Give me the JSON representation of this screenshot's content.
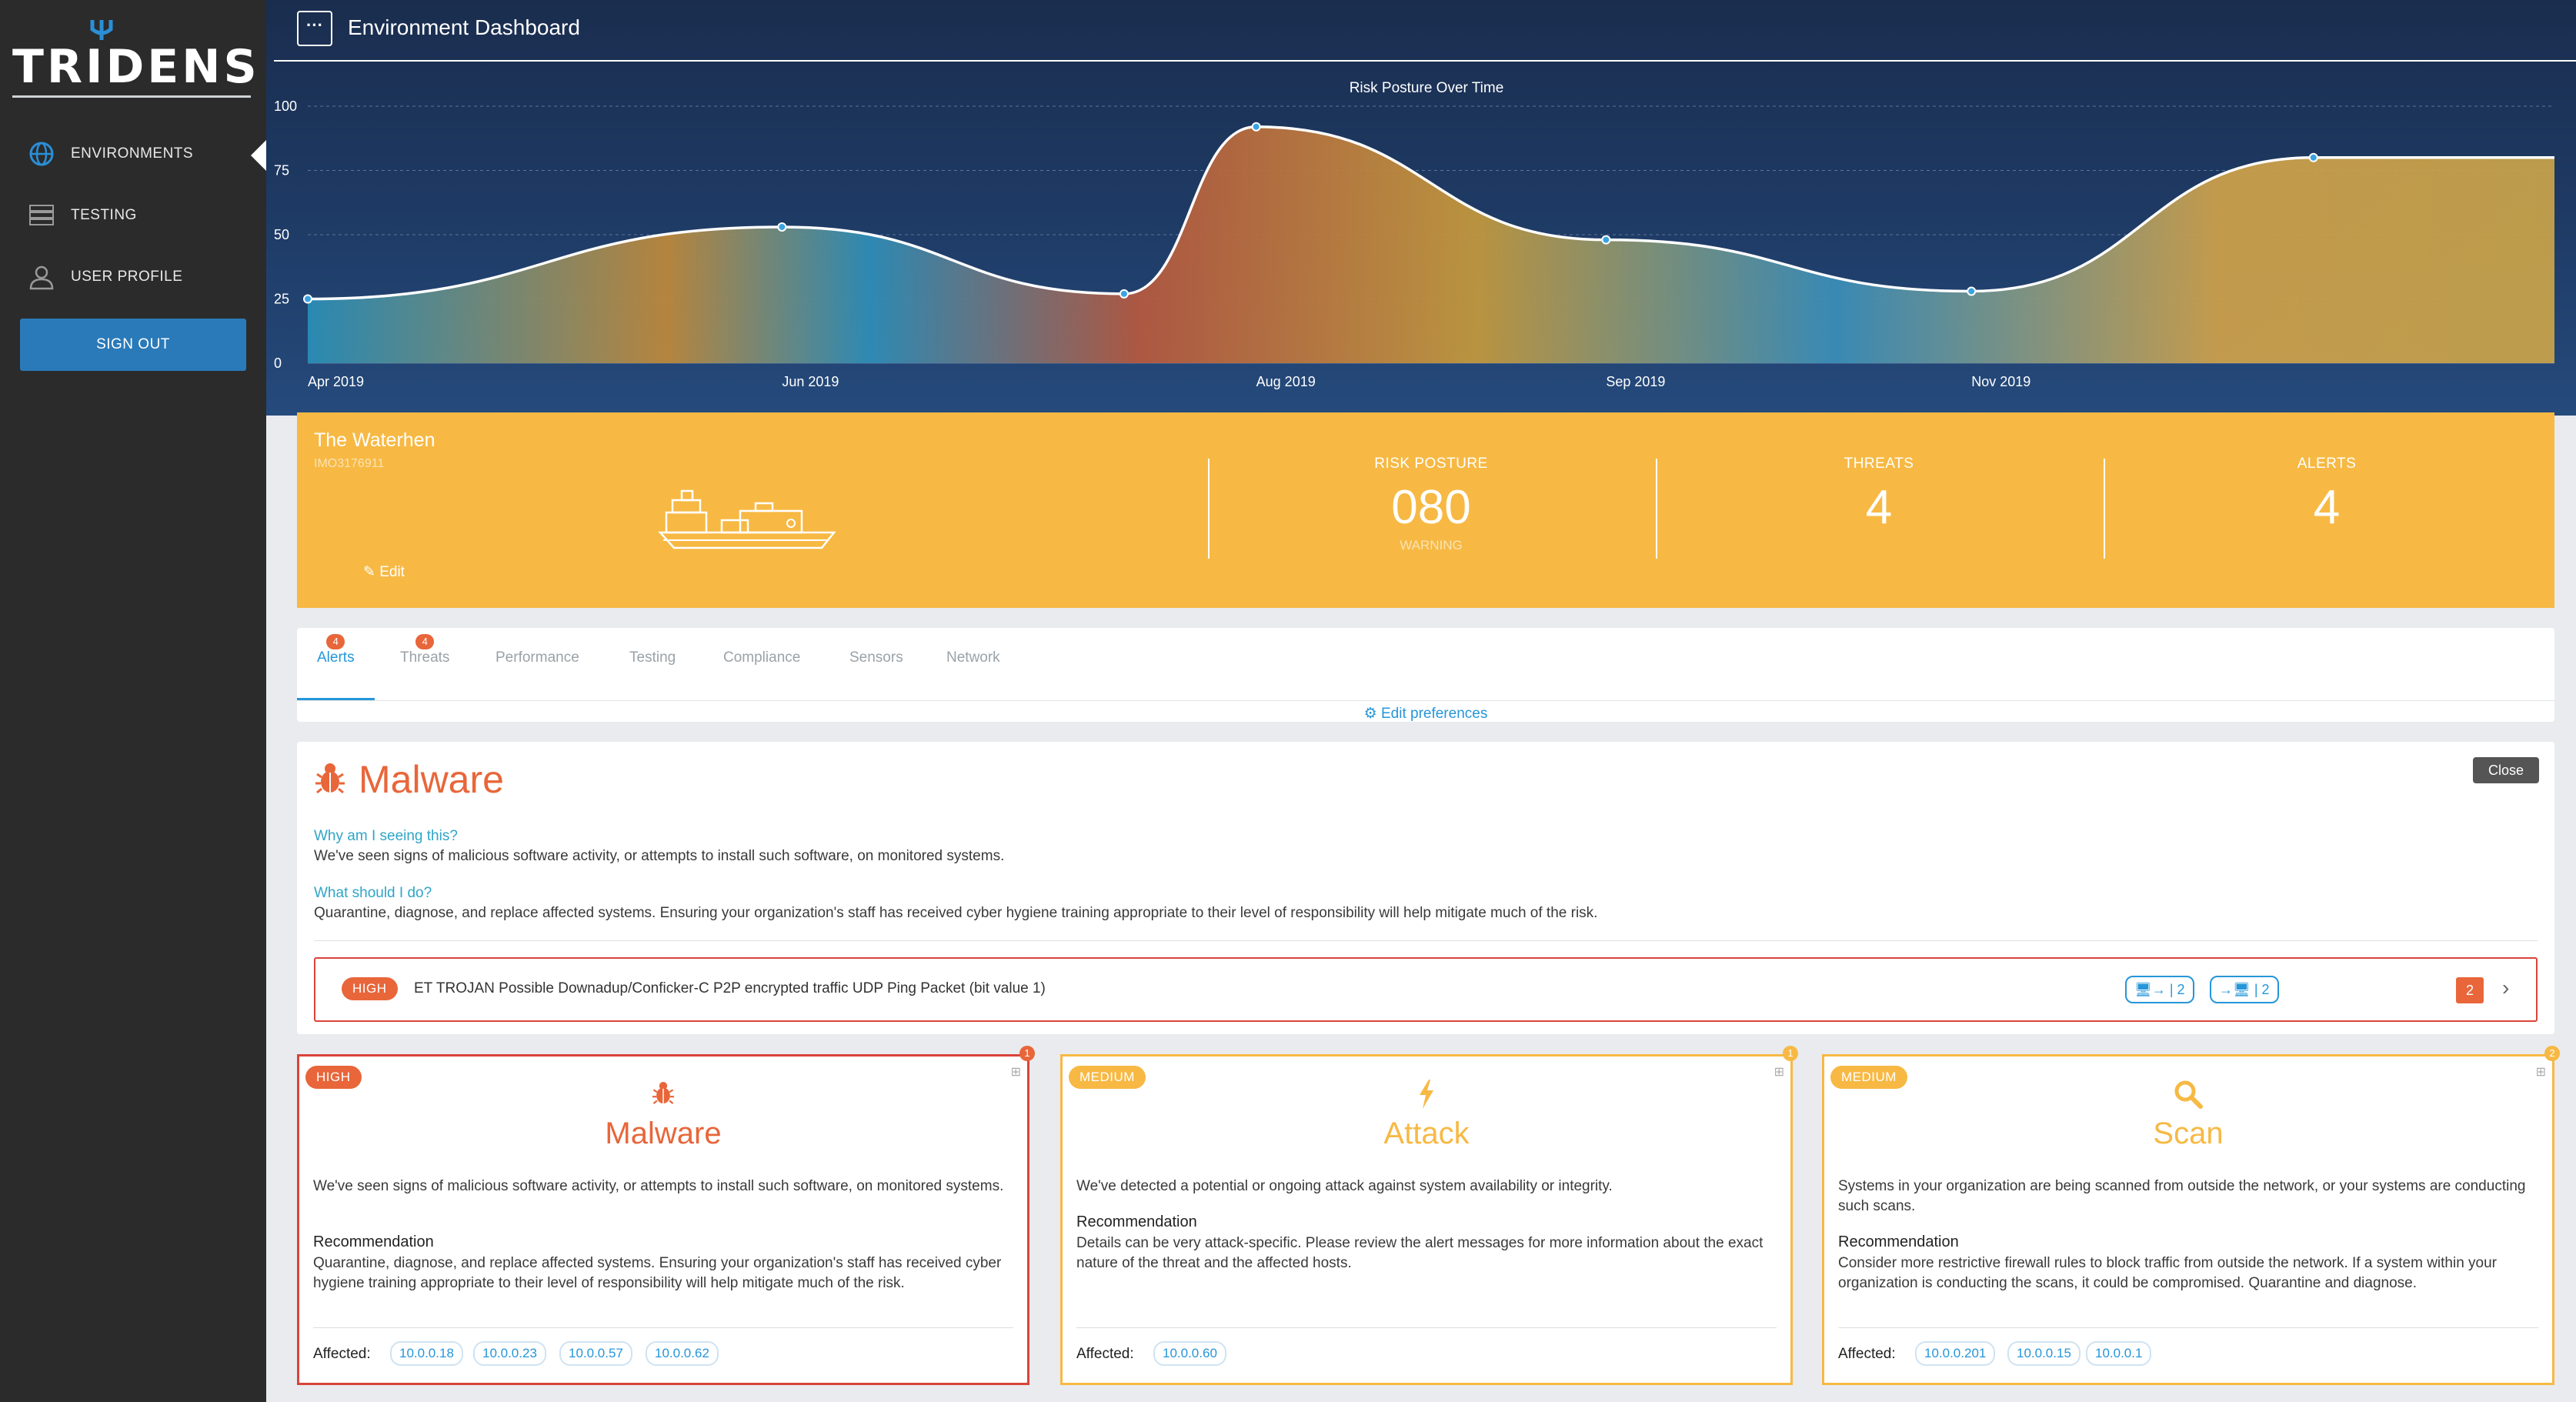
{
  "brand": {
    "logo_text": "TRIDENS"
  },
  "sidebar": {
    "items": [
      {
        "label": "ENVIRONMENTS",
        "icon": "globe-icon",
        "active": true
      },
      {
        "label": "TESTING",
        "icon": "server-rack-icon",
        "active": false
      },
      {
        "label": "USER PROFILE",
        "icon": "user-icon",
        "active": false
      }
    ],
    "signout_label": "SIGN OUT"
  },
  "header": {
    "title": "Environment Dashboard",
    "menu_label": "···"
  },
  "chart_data": {
    "type": "area",
    "title": "Risk Posture Over Time",
    "x_tick_labels": [
      "Apr 2019",
      "Jun 2019",
      "Aug 2019",
      "Sep 2019",
      "Nov 2019"
    ],
    "y_ticks": [
      0,
      25,
      50,
      75,
      100
    ],
    "ylim": [
      0,
      100
    ],
    "grid": true,
    "series": [
      {
        "x": [
          "2019-04-01",
          "2019-06-01",
          "2019-07-15",
          "2019-08-01",
          "2019-09-15",
          "2019-11-01",
          "2019-12-15",
          "2020-01-15"
        ],
        "values": [
          25,
          53,
          27,
          92,
          48,
          28,
          80,
          80
        ]
      }
    ]
  },
  "vessel": {
    "name": "The Waterhen",
    "id": "IMO3176911",
    "edit_label": "Edit",
    "stats": [
      {
        "label": "RISK POSTURE",
        "value": "080",
        "sub": "WARNING"
      },
      {
        "label": "THREATS",
        "value": "4",
        "sub": ""
      },
      {
        "label": "ALERTS",
        "value": "4",
        "sub": ""
      }
    ]
  },
  "tabs": {
    "items": [
      {
        "label": "Alerts",
        "badge": "4",
        "active": true
      },
      {
        "label": "Threats",
        "badge": "4",
        "active": false
      },
      {
        "label": "Performance",
        "badge": "",
        "active": false
      },
      {
        "label": "Testing",
        "badge": "",
        "active": false
      },
      {
        "label": "Compliance",
        "badge": "",
        "active": false
      },
      {
        "label": "Sensors",
        "badge": "",
        "active": false
      },
      {
        "label": "Network",
        "badge": "",
        "active": false
      }
    ],
    "edit_preferences": "Edit preferences"
  },
  "detail": {
    "title": "Malware",
    "close_label": "Close",
    "why_q": "Why am I seeing this?",
    "why_a": "We've seen signs of malicious software activity, or attempts to install such software, on monitored systems.",
    "what_q": "What should I do?",
    "what_a": "Quarantine, diagnose, and replace affected systems. Ensuring your organization's staff has received cyber hygiene training appropriate to their level of responsibility will help mitigate much of the risk.",
    "alert": {
      "severity": "HIGH",
      "text": "ET TROJAN Possible Downadup/Conficker-C P2P encrypted traffic UDP Ping Packet (bit value 1)",
      "src_count": "2",
      "dst_count": "2",
      "count": "2"
    }
  },
  "cards": [
    {
      "severity": "HIGH",
      "corner": "1",
      "title": "Malware",
      "desc": "We've seen signs of malicious software activity, or attempts to install such software, on monitored systems.",
      "rec_heading": "Recommendation",
      "rec": "Quarantine, diagnose, and replace affected systems. Ensuring your organization's staff has received cyber hygiene training appropriate to their level of responsibility will help mitigate much of the risk.",
      "affected_label": "Affected:",
      "ips": [
        "10.0.0.18",
        "10.0.0.23",
        "10.0.0.57",
        "10.0.0.62"
      ],
      "color": "#d9443a",
      "accent": "#e8663a",
      "icon": "bug-icon"
    },
    {
      "severity": "MEDIUM",
      "corner": "1",
      "title": "Attack",
      "desc": "We've detected a potential or ongoing attack against system availability or integrity.",
      "rec_heading": "Recommendation",
      "rec": "Details can be very attack-specific. Please review the alert messages for more information about the exact nature of the threat and the affected hosts.",
      "affected_label": "Affected:",
      "ips": [
        "10.0.0.60"
      ],
      "color": "#f7b944",
      "accent": "#f7b944",
      "icon": "lightning-icon"
    },
    {
      "severity": "MEDIUM",
      "corner": "2",
      "title": "Scan",
      "desc": "Systems in your organization are being scanned from outside the network, or your systems are conducting such scans.",
      "rec_heading": "Recommendation",
      "rec": "Consider more restrictive firewall rules to block traffic from outside the network. If a system within your organization is conducting the scans, it could be compromised. Quarantine and diagnose.",
      "affected_label": "Affected:",
      "ips": [
        "10.0.0.201",
        "10.0.0.15",
        "10.0.0.1"
      ],
      "color": "#f7b944",
      "accent": "#f7b944",
      "icon": "search-icon"
    }
  ]
}
